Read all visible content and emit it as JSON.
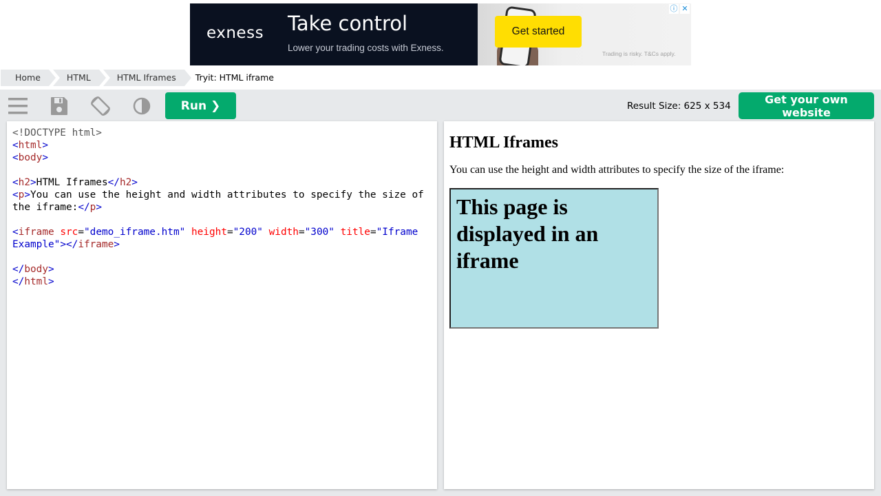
{
  "ad": {
    "logo": "exness",
    "headline": "Take control",
    "subtext": "Lower your trading costs with Exness.",
    "cta": "Get started",
    "disclaimer": "Trading is risky. T&Cs apply.",
    "info_icon": "ⓘ",
    "close_icon": "✕",
    "colors": {
      "background": "#0a1120",
      "cta": "#ffde02"
    }
  },
  "breadcrumb": {
    "items": [
      "Home",
      "HTML",
      "HTML Iframes"
    ],
    "current": "Tryit: HTML iframe"
  },
  "toolbar": {
    "icons": [
      "menu-icon",
      "save-icon",
      "rotate-icon",
      "contrast-icon"
    ],
    "run_label": "Run ❯",
    "result_size": "Result Size: 625 x 534",
    "own_website_label": "Get your own website",
    "colors": {
      "accent": "#04aa6d",
      "toolbar_bg": "#e7e9eb"
    }
  },
  "editor": {
    "lines": [
      [
        [
          "doc",
          "<!DOCTYPE html>"
        ]
      ],
      [
        [
          "br",
          "<"
        ],
        [
          "tag",
          "html"
        ],
        [
          "br",
          ">"
        ]
      ],
      [
        [
          "br",
          "<"
        ],
        [
          "tag",
          "body"
        ],
        [
          "br",
          ">"
        ]
      ],
      [],
      [
        [
          "br",
          "<"
        ],
        [
          "tag",
          "h2"
        ],
        [
          "br",
          ">"
        ],
        [
          "txt",
          "HTML Iframes"
        ],
        [
          "br",
          "</"
        ],
        [
          "tag",
          "h2"
        ],
        [
          "br",
          ">"
        ]
      ],
      [
        [
          "br",
          "<"
        ],
        [
          "tag",
          "p"
        ],
        [
          "br",
          ">"
        ],
        [
          "txt",
          "You can use the height and width attributes to specify the size of the iframe:"
        ],
        [
          "br",
          "</"
        ],
        [
          "tag",
          "p"
        ],
        [
          "br",
          ">"
        ]
      ],
      [],
      [
        [
          "br",
          "<"
        ],
        [
          "tag",
          "iframe"
        ],
        [
          "txt",
          " "
        ],
        [
          "attr",
          "src"
        ],
        [
          "txt",
          "="
        ],
        [
          "val",
          "\"demo_iframe.htm\""
        ],
        [
          "txt",
          " "
        ],
        [
          "attr",
          "height"
        ],
        [
          "txt",
          "="
        ],
        [
          "val",
          "\"200\""
        ],
        [
          "txt",
          " "
        ],
        [
          "attr",
          "width"
        ],
        [
          "txt",
          "="
        ],
        [
          "val",
          "\"300\""
        ],
        [
          "txt",
          " "
        ],
        [
          "attr",
          "title"
        ],
        [
          "txt",
          "="
        ],
        [
          "val",
          "\"Iframe Example\""
        ],
        [
          "br",
          "></"
        ],
        [
          "tag",
          "iframe"
        ],
        [
          "br",
          ">"
        ]
      ],
      [],
      [
        [
          "br",
          "</"
        ],
        [
          "tag",
          "body"
        ],
        [
          "br",
          ">"
        ]
      ],
      [
        [
          "br",
          "</"
        ],
        [
          "tag",
          "html"
        ],
        [
          "br",
          ">"
        ]
      ]
    ]
  },
  "result": {
    "heading": "HTML Iframes",
    "paragraph": "You can use the height and width attributes to specify the size of the iframe:",
    "iframe_heading": "This page is displayed in an iframe",
    "iframe_background": "#b0e0e6"
  }
}
